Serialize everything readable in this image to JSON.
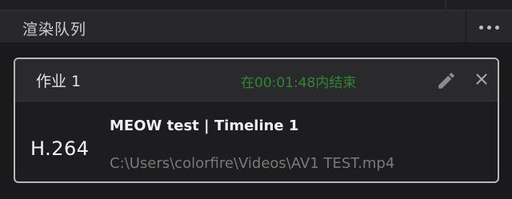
{
  "panel": {
    "title": "渲染队列",
    "more_icon": "more-horizontal-icon"
  },
  "job": {
    "name": "作业 1",
    "status": "在00:01:48内结束",
    "status_color": "#2b8a2b",
    "edit_icon": "pencil-icon",
    "close_icon": "close-icon",
    "codec": "H.264",
    "title": "MEOW test | Timeline 1",
    "output_path": "C:\\Users\\colorfire\\Videos\\AV1 TEST.mp4"
  }
}
